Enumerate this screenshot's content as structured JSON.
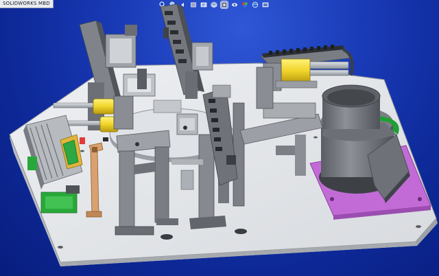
{
  "app": {
    "title": "SOLIDWORKS MBD"
  },
  "heads_up_toolbar": {
    "tools": [
      {
        "name": "zoom-to-fit-icon"
      },
      {
        "name": "zoom-area-icon"
      },
      {
        "name": "previous-view-icon"
      },
      {
        "name": "section-view-icon"
      },
      {
        "name": "dynamic-annotation-icon"
      },
      {
        "name": "view-orientation-icon"
      },
      {
        "name": "display-style-icon",
        "active": true
      },
      {
        "name": "hide-show-items-icon"
      },
      {
        "name": "edit-appearance-icon"
      },
      {
        "name": "apply-scene-icon"
      },
      {
        "name": "view-settings-icon"
      }
    ]
  },
  "model": {
    "name": "assembly-machine-model"
  },
  "colors": {
    "background_top": "#2f58d6",
    "background_bottom": "#081d7e",
    "base_plate": "#e8eaee",
    "frame_gray": "#8c9096",
    "cylinder_yellow": "#f1d52a",
    "bowl_feeder_purple": "#c26bd6",
    "accent_green": "#29a83a",
    "bracket_orange": "#d9a070"
  }
}
